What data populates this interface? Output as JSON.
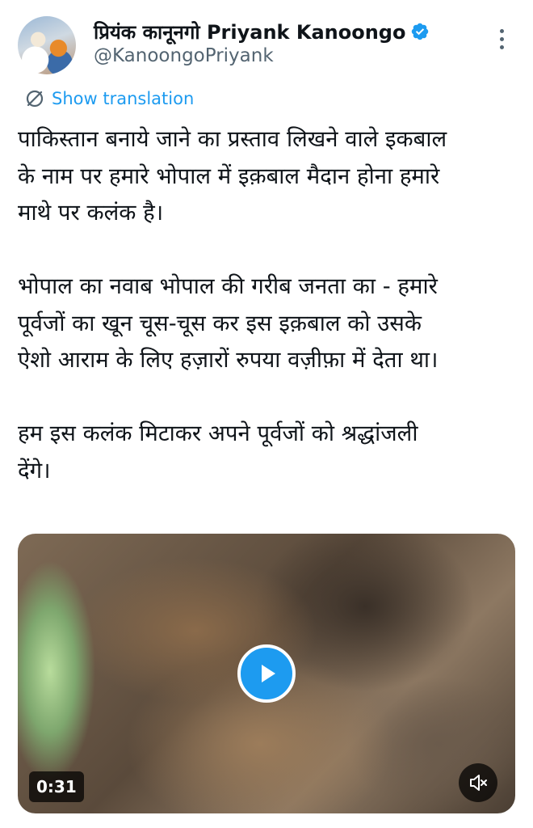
{
  "author": {
    "display_name": "प्रियंक कानूनगो Priyank Kanoongo",
    "handle": "@KanoongoPriyank",
    "verified_icon": "verified-badge-icon",
    "avatar_icon": "profile-photo"
  },
  "translate": {
    "label": "Show translation",
    "icon": "translate-globe-icon"
  },
  "tweet": {
    "lines": [
      "पाकिस्तान बनाये जाने का प्रस्ताव लिखने वाले इकबाल",
      "के नाम पर हमारे भोपाल में इक़बाल मैदान होना हमारे",
      "माथे पर कलंक है।",
      "",
      "भोपाल का नवाब भोपाल की गरीब जनता का - हमारे",
      "पूर्वजों का खून चूस-चूस कर इस इक़बाल को उसके",
      "ऐशो आराम के लिए हज़ारों रुपया वज़ीफ़ा में देता था।",
      "",
      "हम इस कलंक मिटाकर अपने पूर्वजों को श्रद्धांजली",
      "देंगे।"
    ]
  },
  "media": {
    "duration": "0:31",
    "play_icon": "play-icon",
    "mute_icon": "muted-speaker-icon"
  },
  "colors": {
    "accent": "#1d9bf0",
    "text_primary": "#0f1419",
    "text_secondary": "#536471"
  }
}
